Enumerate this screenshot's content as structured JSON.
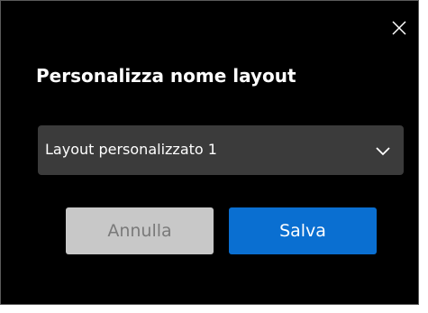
{
  "dialog": {
    "title": "Personalizza nome layout",
    "close_icon": "close-icon",
    "select": {
      "value": "Layout personalizzato 1",
      "icon": "chevron-down-icon"
    },
    "buttons": {
      "cancel_label": "Annulla",
      "save_label": "Salva"
    }
  },
  "colors": {
    "background": "#000000",
    "select_bg": "#3b3b3b",
    "cancel_bg": "#c8c8c8",
    "cancel_text": "#7a7a7a",
    "accent": "#0a6fd1",
    "text": "#ffffff"
  }
}
